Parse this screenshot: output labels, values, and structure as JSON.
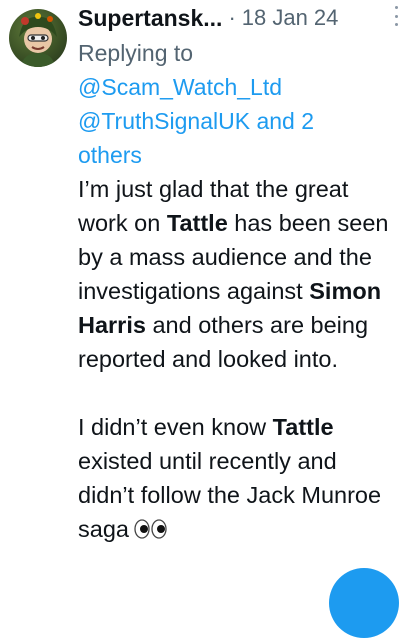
{
  "tweet": {
    "display_name": "Supertansk...",
    "separator": "·",
    "date": "18 Jan 24",
    "reply_prefix": "Replying to ",
    "reply_mention_1": "@Scam_Watch_Ltd",
    "reply_mention_2": "@TruthSignalUK and 2 others",
    "p1_a": "I’m just glad that the great work on ",
    "p1_b": "Tattle",
    "p1_c": " has been seen by a mass audience and the investigations against ",
    "p1_d": "Simon Harris",
    "p1_e": " and others are being reported and looked into.",
    "p2_a": "I didn’t even know ",
    "p2_b": "Tattle",
    "p2_c": " existed until recently and didn’t follow the Jack Munroe saga",
    "emoji": "eyes-emoji",
    "avatar_icon": "profile-avatar",
    "more_icon": "more-options-icon"
  },
  "colors": {
    "link": "#1d9bf0",
    "muted": "#536471",
    "text": "#0f1419",
    "fab": "#1d9bf0"
  }
}
